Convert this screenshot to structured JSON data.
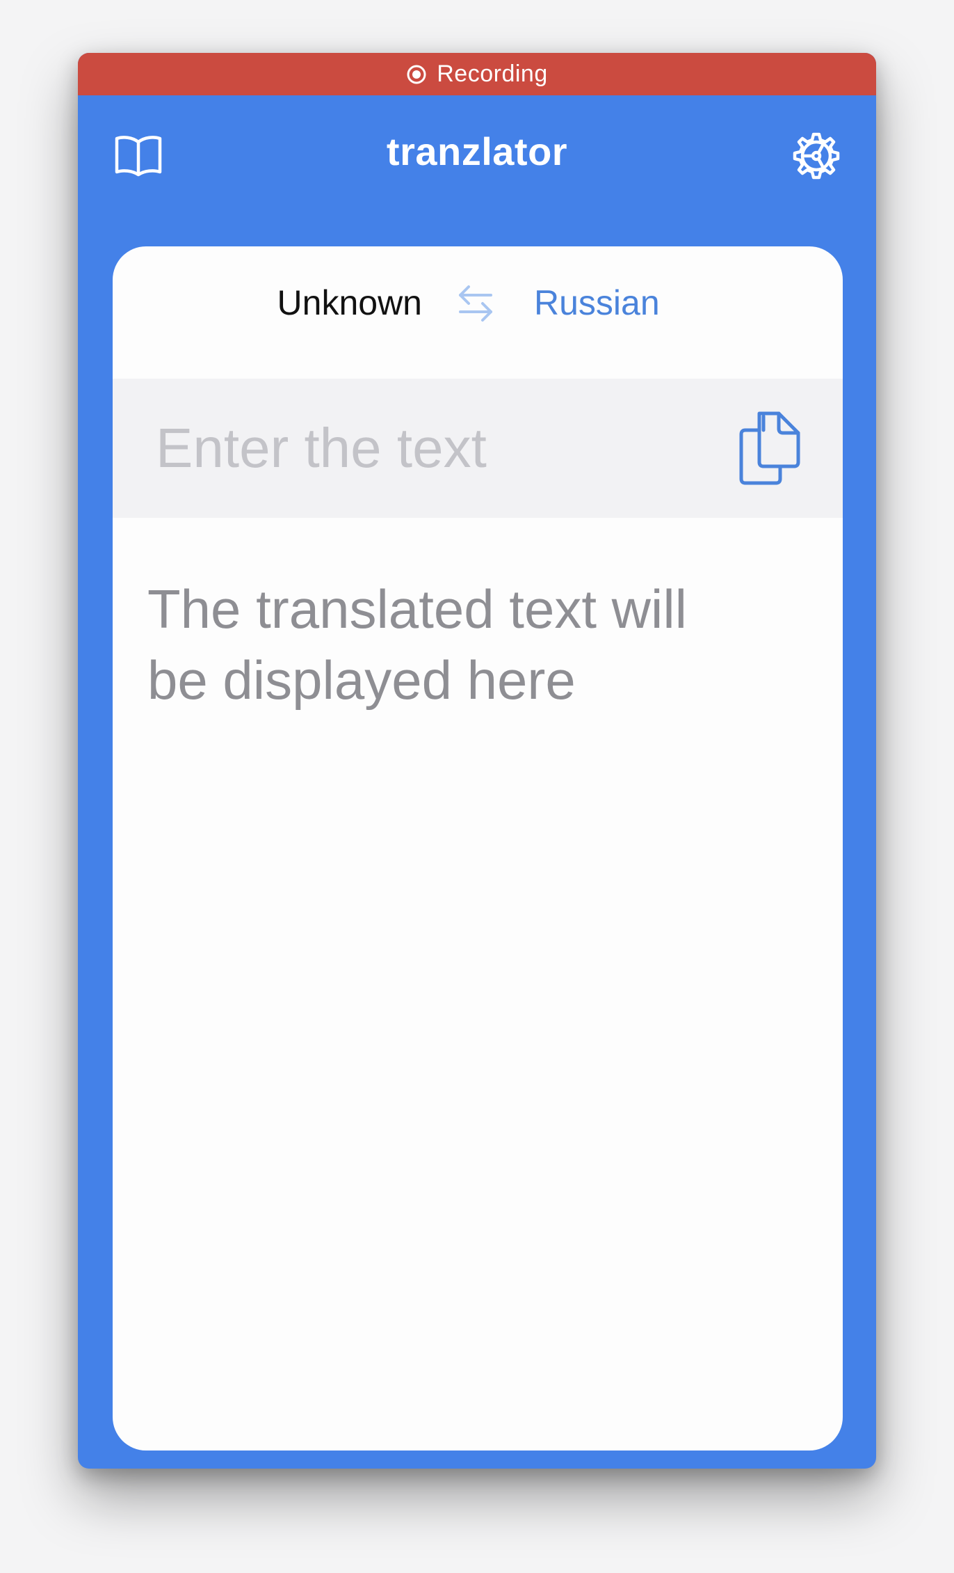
{
  "recording": {
    "label": "Recording"
  },
  "header": {
    "title": "tranzlator",
    "left_icon": "book-icon",
    "right_icon": "gear-icon"
  },
  "languages": {
    "source": "Unknown",
    "target": "Russian",
    "swap_icon": "swap-arrows-icon"
  },
  "input": {
    "value": "",
    "placeholder": "Enter the text",
    "paste_icon": "paste-icon"
  },
  "output": {
    "placeholder": "The translated text will be displayed here"
  },
  "colors": {
    "recording_bar": "#cb4b40",
    "header_background": "#4481e8",
    "accent": "#4a83db",
    "input_background": "#f2f2f4",
    "placeholder_text": "#8e8e93"
  }
}
